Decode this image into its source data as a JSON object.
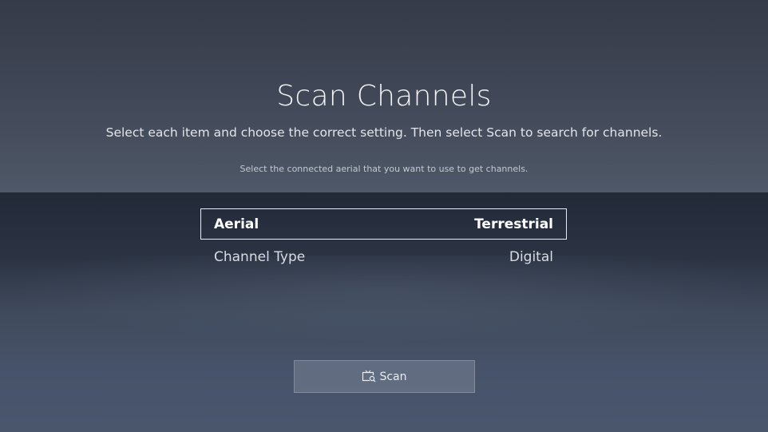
{
  "screen": {
    "title": "Scan Channels",
    "subtitle": "Select each item and choose the correct setting. Then select Scan to search for channels.",
    "hint": "Select the connected aerial that you want to use to get channels."
  },
  "settings": [
    {
      "label": "Aerial",
      "value": "Terrestrial",
      "focused": true
    },
    {
      "label": "Channel Type",
      "value": "Digital",
      "focused": false
    }
  ],
  "scan_button": {
    "label": "Scan",
    "icon": "tv-search-icon"
  },
  "colors": {
    "focus_border": "#e9ecf0",
    "top_bg": "#3f4655",
    "bottom_bg": "#2c3444"
  }
}
